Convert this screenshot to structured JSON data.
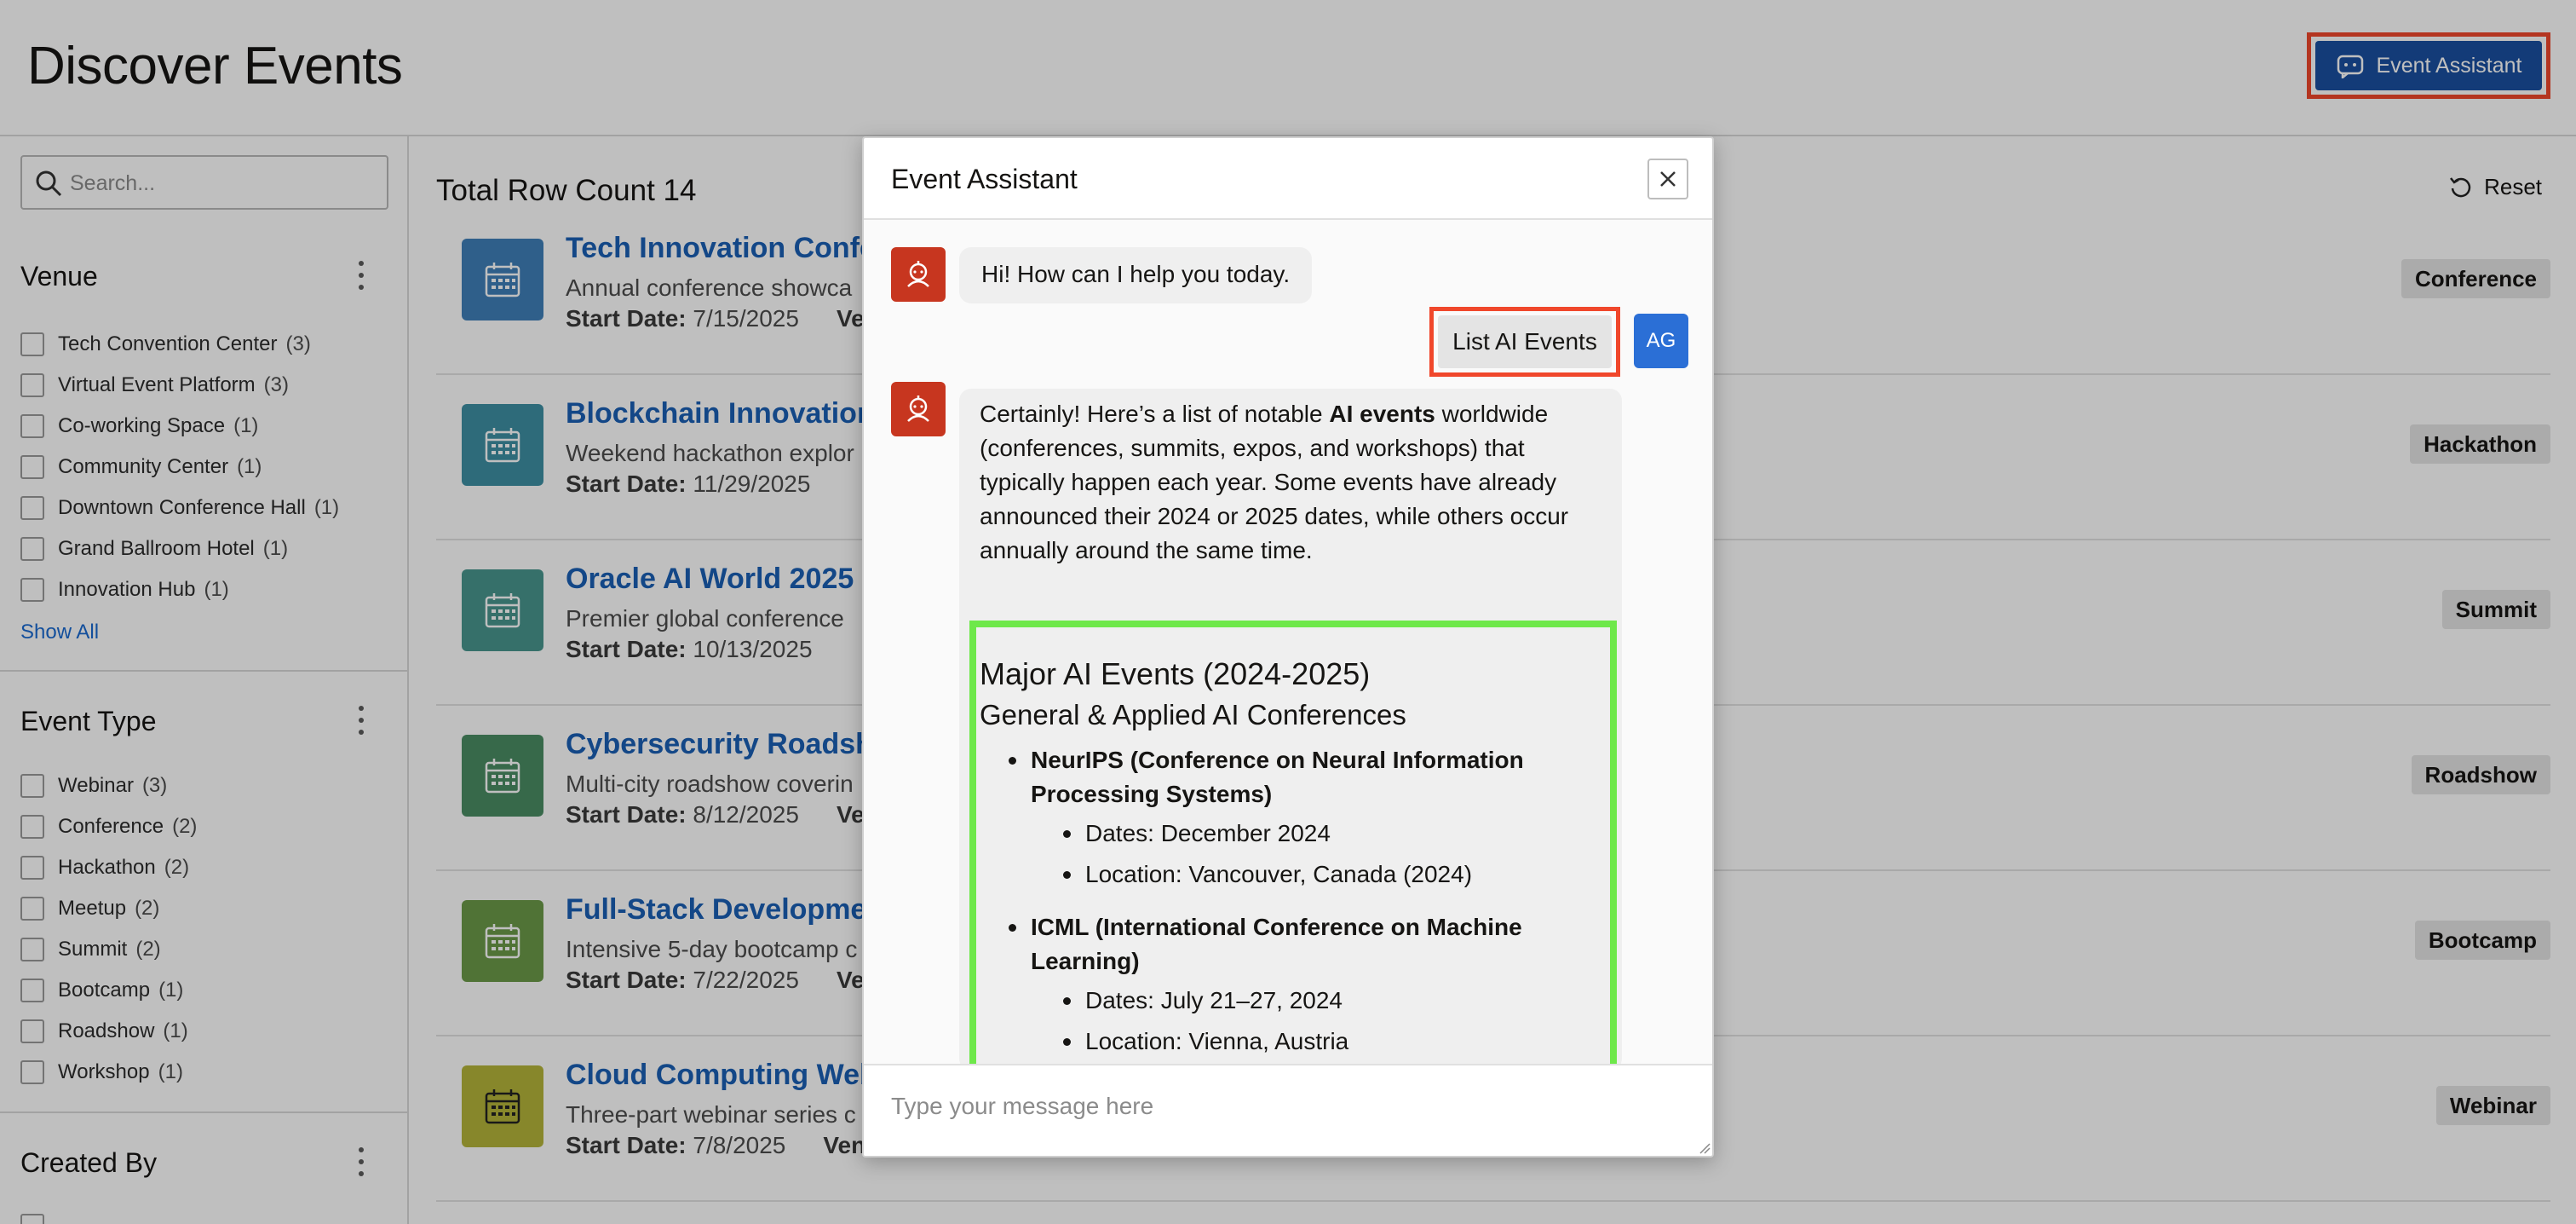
{
  "header": {
    "title": "Discover Events",
    "assistant_button": "Event Assistant"
  },
  "search": {
    "placeholder": "Search..."
  },
  "facets": {
    "venue": {
      "title": "Venue",
      "items": [
        {
          "label": "Tech Convention Center",
          "count": "(3)"
        },
        {
          "label": "Virtual Event Platform",
          "count": "(3)"
        },
        {
          "label": "Co-working Space",
          "count": "(1)"
        },
        {
          "label": "Community Center",
          "count": "(1)"
        },
        {
          "label": "Downtown Conference Hall",
          "count": "(1)"
        },
        {
          "label": "Grand Ballroom Hotel",
          "count": "(1)"
        },
        {
          "label": "Innovation Hub",
          "count": "(1)"
        }
      ],
      "show_all": "Show All"
    },
    "event_type": {
      "title": "Event Type",
      "items": [
        {
          "label": "Webinar",
          "count": "(3)"
        },
        {
          "label": "Conference",
          "count": "(2)"
        },
        {
          "label": "Hackathon",
          "count": "(2)"
        },
        {
          "label": "Meetup",
          "count": "(2)"
        },
        {
          "label": "Summit",
          "count": "(2)"
        },
        {
          "label": "Bootcamp",
          "count": "(1)"
        },
        {
          "label": "Roadshow",
          "count": "(1)"
        },
        {
          "label": "Workshop",
          "count": "(1)"
        }
      ]
    },
    "created_by": {
      "title": "Created By"
    }
  },
  "results": {
    "row_count": "Total Row Count 14",
    "reset": "Reset",
    "start_date_label": "Start Date:",
    "venue_label": "Venue:",
    "cards": [
      {
        "title": "Tech Innovation Confe",
        "desc": "Annual conference showca",
        "date": "7/15/2025",
        "tag": "Conference",
        "color": "#3f7fb8",
        "show_venue": true
      },
      {
        "title": "Blockchain Innovation",
        "desc": "Weekend hackathon explor",
        "date": "11/29/2025",
        "tag": "Hackathon",
        "color": "#3e8fa3",
        "show_venue": false
      },
      {
        "title": "Oracle AI World 2025",
        "desc": "Premier global conference",
        "date": "10/13/2025",
        "tag": "Summit",
        "color": "#48968e",
        "show_venue": false
      },
      {
        "title": "Cybersecurity Roadsho",
        "desc": "Multi-city roadshow coverin",
        "date": "8/12/2025",
        "tag": "Roadshow",
        "color": "#4a8c63",
        "show_venue": true
      },
      {
        "title": "Full-Stack Developmen",
        "desc": "Intensive 5-day bootcamp c",
        "date": "7/22/2025",
        "tag": "Bootcamp",
        "color": "#6b9a48",
        "show_venue": true
      },
      {
        "title": "Cloud Computing Web",
        "desc": "Three-part webinar series c",
        "date": "7/8/2025",
        "tag": "Webinar",
        "color": "#b5b53a",
        "show_venue": true
      }
    ]
  },
  "assistant": {
    "title": "Event Assistant",
    "greeting": "Hi! How can I help you today.",
    "user_message": "List AI Events",
    "user_initials": "AG",
    "reply_intro_1": "Certainly! Here’s a list of notable ",
    "reply_intro_bold": "AI events",
    "reply_intro_2": " worldwide (conferences, summits, expos, and workshops) that typically happen each year. Some events have already announced their 2024 or 2025 dates, while others occur annually around the same time.",
    "heading_major": "Major AI Events (2024-2025)",
    "heading_general": "General & Applied AI Conferences",
    "events": [
      {
        "name": "NeurIPS (Conference on Neural Information Processing Systems)",
        "dates": "Dates: December 2024",
        "location": "Location: Vancouver, Canada (2024)"
      },
      {
        "name": "ICML (International Conference on Machine Learning)",
        "dates": "Dates: July 21–27, 2024",
        "location": "Location: Vienna, Austria"
      }
    ],
    "composer_placeholder": "Type your message here"
  }
}
